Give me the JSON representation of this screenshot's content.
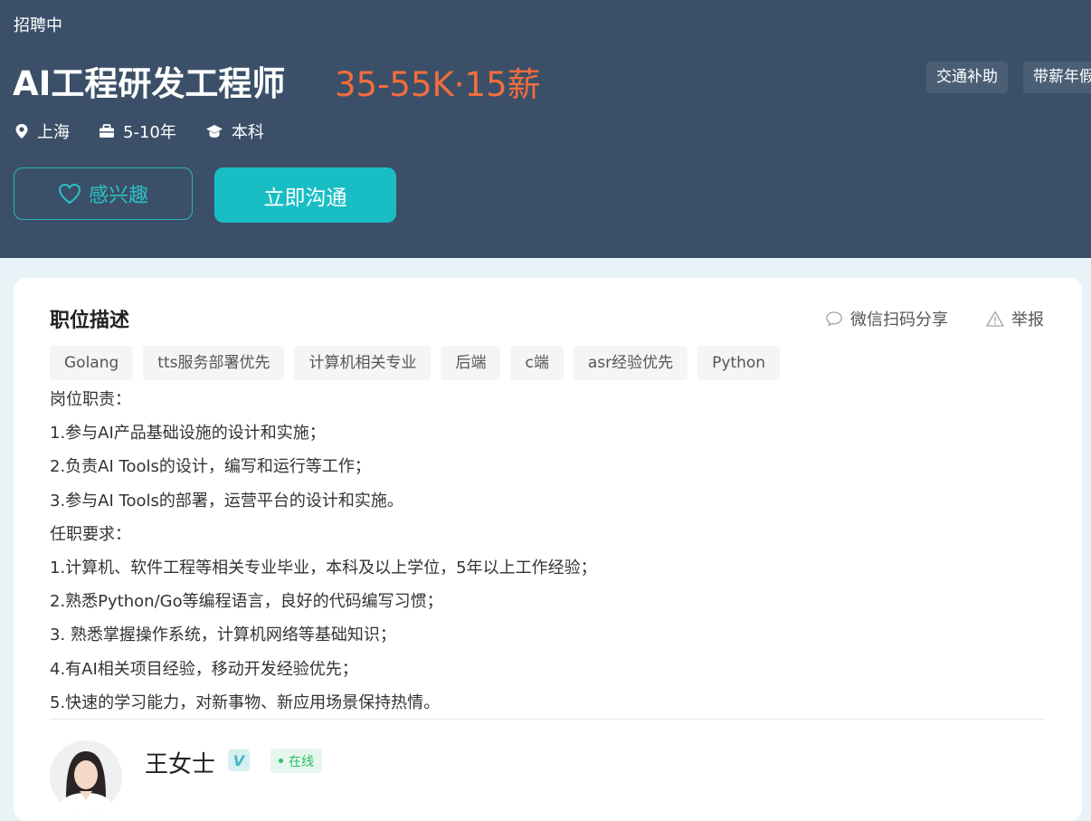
{
  "header": {
    "status": "招聘中",
    "title": "AI工程研发工程师",
    "salary": "35-55K·15薪",
    "benefits": [
      "交通补助",
      "带薪年假"
    ],
    "meta": {
      "location": "上海",
      "experience": "5-10年",
      "education": "本科"
    },
    "interest_label": "感兴趣",
    "chat_label": "立即沟通"
  },
  "description": {
    "title": "职位描述",
    "share_label": "微信扫码分享",
    "report_label": "举报",
    "tags": [
      "Golang",
      "tts服务部署优先",
      "计算机相关专业",
      "后端",
      "c端",
      "asr经验优先",
      "Python"
    ],
    "lines": [
      "岗位职责：",
      "1.参与AI产品基础设施的设计和实施；",
      "2.负责AI Tools的设计，编写和运行等工作；",
      "3.参与AI Tools的部署，运营平台的设计和实施。",
      "任职要求：",
      "1.计算机、软件工程等相关专业毕业，本科及以上学位，5年以上工作经验；",
      "2.熟悉Python/Go等编程语言，良好的代码编写习惯；",
      "3. 熟悉掌握操作系统，计算机网络等基础知识；",
      "4.有AI相关项目经验，移动开发经验优先；",
      "5.快速的学习能力，对新事物、新应用场景保持热情。"
    ]
  },
  "recruiter": {
    "name": "王女士",
    "verified_mark": "V",
    "status": "在线"
  },
  "colors": {
    "header_bg": "#3b5068",
    "salary": "#f26d3d",
    "accent": "#19bec5",
    "online": "#2bbb66"
  }
}
